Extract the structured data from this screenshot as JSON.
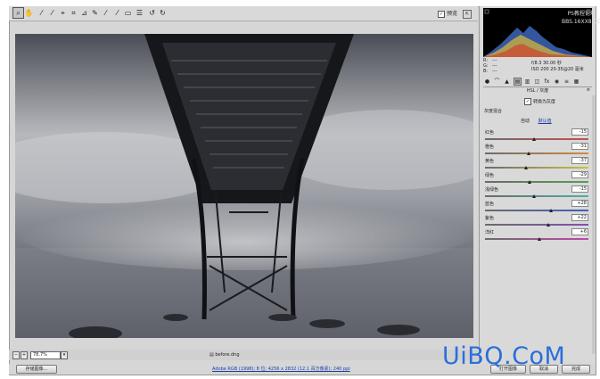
{
  "toolbar": {
    "tools": [
      "zoom-icon",
      "hand-icon",
      "eyedropper-icon",
      "color-sampler-icon",
      "target-adjust-icon",
      "crop-icon",
      "straighten-icon",
      "spot-removal-icon",
      "red-eye-icon",
      "adjustment-brush-icon",
      "graduated-filter-icon",
      "preferences-icon",
      "rotate-ccw-icon",
      "rotate-cw-icon"
    ],
    "preview_label": "预览",
    "fullscreen_icon": "fullscreen-icon"
  },
  "watermark_site": {
    "line1": "PS教程论坛",
    "line2": "BBS.16XX8.COM"
  },
  "histogram": {
    "r": "R:",
    "g": "G:",
    "b": "B:",
    "r_val": "---",
    "g_val": "---",
    "b_val": "---",
    "exposure": "f/8.3  30.00 秒",
    "iso": "ISO 200  20-35@20 毫米"
  },
  "panel": {
    "tab_icons": [
      "basic-icon",
      "tone-curve-icon",
      "detail-icon",
      "hsl-icon",
      "split-toning-icon",
      "lens-icon",
      "effects-icon",
      "camera-calibration-icon",
      "presets-icon",
      "snapshots-icon"
    ],
    "section_title": "HSL / 灰度",
    "convert_gray_label": "转换为灰度",
    "mix_heading": "灰度混合",
    "auto_label": "自动",
    "default_label": "默认值",
    "sliders": [
      {
        "label": "红色",
        "value": "-15",
        "pos": 0.47,
        "gradient": [
          "#6b6b6b",
          "#c85050"
        ]
      },
      {
        "label": "橙色",
        "value": "-31",
        "pos": 0.42,
        "gradient": [
          "#6b6b6b",
          "#d28a40"
        ]
      },
      {
        "label": "黄色",
        "value": "-37",
        "pos": 0.4,
        "gradient": [
          "#6b6b6b",
          "#cdc040"
        ]
      },
      {
        "label": "绿色",
        "value": "-29",
        "pos": 0.43,
        "gradient": [
          "#6b6b6b",
          "#55a050"
        ]
      },
      {
        "label": "浅绿色",
        "value": "-15",
        "pos": 0.47,
        "gradient": [
          "#6b6b6b",
          "#4bb0a8"
        ]
      },
      {
        "label": "蓝色",
        "value": "+28",
        "pos": 0.64,
        "gradient": [
          "#6b6b6b",
          "#4060c0"
        ]
      },
      {
        "label": "紫色",
        "value": "+22",
        "pos": 0.61,
        "gradient": [
          "#6b6b6b",
          "#8050b0"
        ]
      },
      {
        "label": "洋红",
        "value": "+6",
        "pos": 0.53,
        "gradient": [
          "#6b6b6b",
          "#c04aa0"
        ]
      }
    ]
  },
  "status": {
    "zoom": "78.7%",
    "filename": "before.dng"
  },
  "bottom": {
    "save_label": "存储图像...",
    "workflow": "Adobe RGB (1998); 8 位; 4256 x 2832 (12.1 百万像素); 240 ppi",
    "open_label": "打开图像",
    "cancel_label": "取消",
    "done_label": "完成"
  },
  "watermark_text": "UiBQ.CoM"
}
